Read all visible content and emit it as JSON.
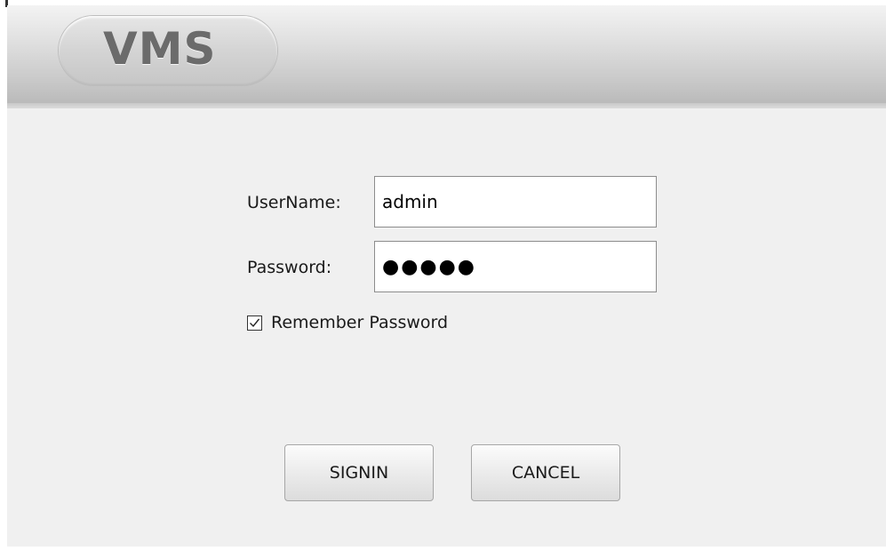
{
  "app": {
    "logo_text": "VMS"
  },
  "login": {
    "username_label": "UserName:",
    "username_value": "admin",
    "password_label": "Password:",
    "password_value": "●●●●●",
    "remember_label": "Remember Password",
    "remember_checked": true
  },
  "buttons": {
    "signin_label": "SIGNIN",
    "cancel_label": "CANCEL"
  },
  "colors": {
    "window_bg": "#f0f0f0",
    "header_gradient_top": "#f3f3f3",
    "header_gradient_bottom": "#bababa",
    "logo_text": "#6b6b6b"
  },
  "icons": {
    "checkbox": "checkmark-icon"
  }
}
